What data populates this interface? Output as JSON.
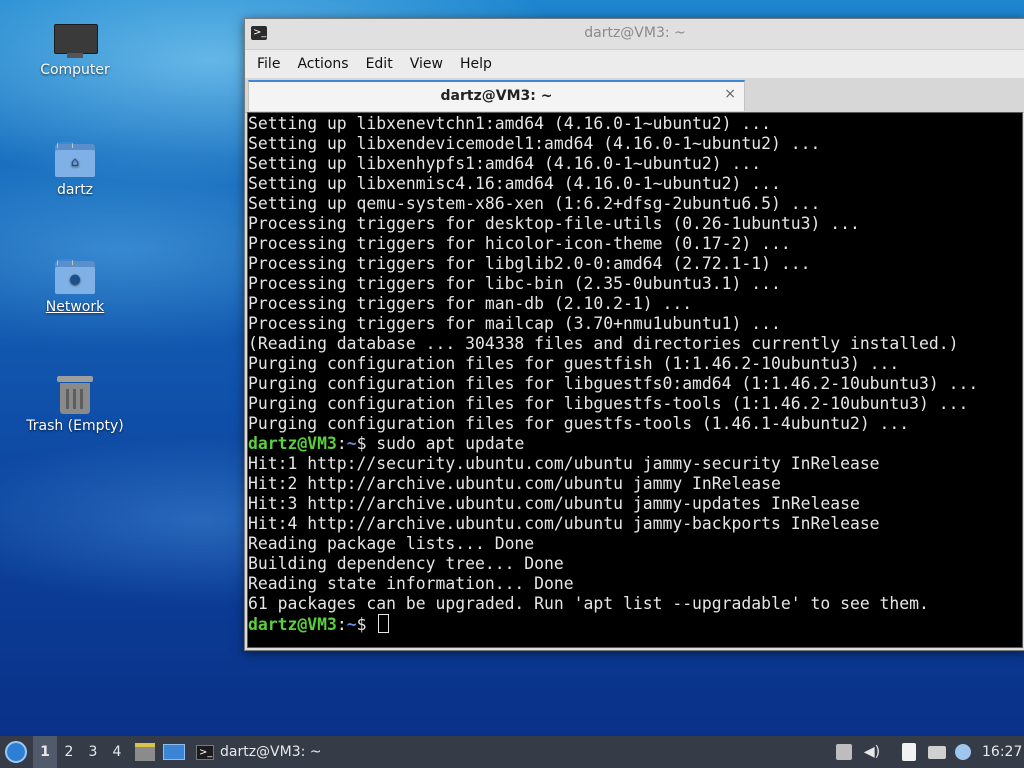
{
  "desktop": {
    "icons": [
      {
        "label": "Computer"
      },
      {
        "label": "dartz"
      },
      {
        "label": "Network"
      },
      {
        "label": "Trash (Empty)"
      }
    ]
  },
  "window": {
    "title": "dartz@VM3: ~",
    "menu": [
      "File",
      "Actions",
      "Edit",
      "View",
      "Help"
    ],
    "tab": {
      "label": "dartz@VM3: ~",
      "close": "×"
    }
  },
  "terminal": {
    "lines": [
      "Setting up libxenevtchn1:amd64 (4.16.0-1~ubuntu2) ...",
      "Setting up libxendevicemodel1:amd64 (4.16.0-1~ubuntu2) ...",
      "Setting up libxenhypfs1:amd64 (4.16.0-1~ubuntu2) ...",
      "Setting up libxenmisc4.16:amd64 (4.16.0-1~ubuntu2) ...",
      "Setting up qemu-system-x86-xen (1:6.2+dfsg-2ubuntu6.5) ...",
      "Processing triggers for desktop-file-utils (0.26-1ubuntu3) ...",
      "Processing triggers for hicolor-icon-theme (0.17-2) ...",
      "Processing triggers for libglib2.0-0:amd64 (2.72.1-1) ...",
      "Processing triggers for libc-bin (2.35-0ubuntu3.1) ...",
      "Processing triggers for man-db (2.10.2-1) ...",
      "Processing triggers for mailcap (3.70+nmu1ubuntu1) ...",
      "(Reading database ... 304338 files and directories currently installed.)",
      "Purging configuration files for guestfish (1:1.46.2-10ubuntu3) ...",
      "Purging configuration files for libguestfs0:amd64 (1:1.46.2-10ubuntu3) ...",
      "Purging configuration files for libguestfs-tools (1:1.46.2-10ubuntu3) ...",
      "Purging configuration files for guestfs-tools (1.46.1-4ubuntu2) ..."
    ],
    "prompt_user": "dartz@VM3",
    "prompt_sep": ":",
    "prompt_path": "~",
    "prompt_end": "$",
    "command": " sudo apt update",
    "output": [
      "Hit:1 http://security.ubuntu.com/ubuntu jammy-security InRelease",
      "Hit:2 http://archive.ubuntu.com/ubuntu jammy InRelease",
      "Hit:3 http://archive.ubuntu.com/ubuntu jammy-updates InRelease",
      "Hit:4 http://archive.ubuntu.com/ubuntu jammy-backports InRelease",
      "Reading package lists... Done",
      "Building dependency tree... Done",
      "Reading state information... Done",
      "61 packages can be upgraded. Run 'apt list --upgradable' to see them."
    ]
  },
  "taskbar": {
    "workspaces": [
      "1",
      "2",
      "3",
      "4"
    ],
    "active_workspace": "1",
    "app_button": "dartz@VM3: ~",
    "clock": "16:27"
  }
}
